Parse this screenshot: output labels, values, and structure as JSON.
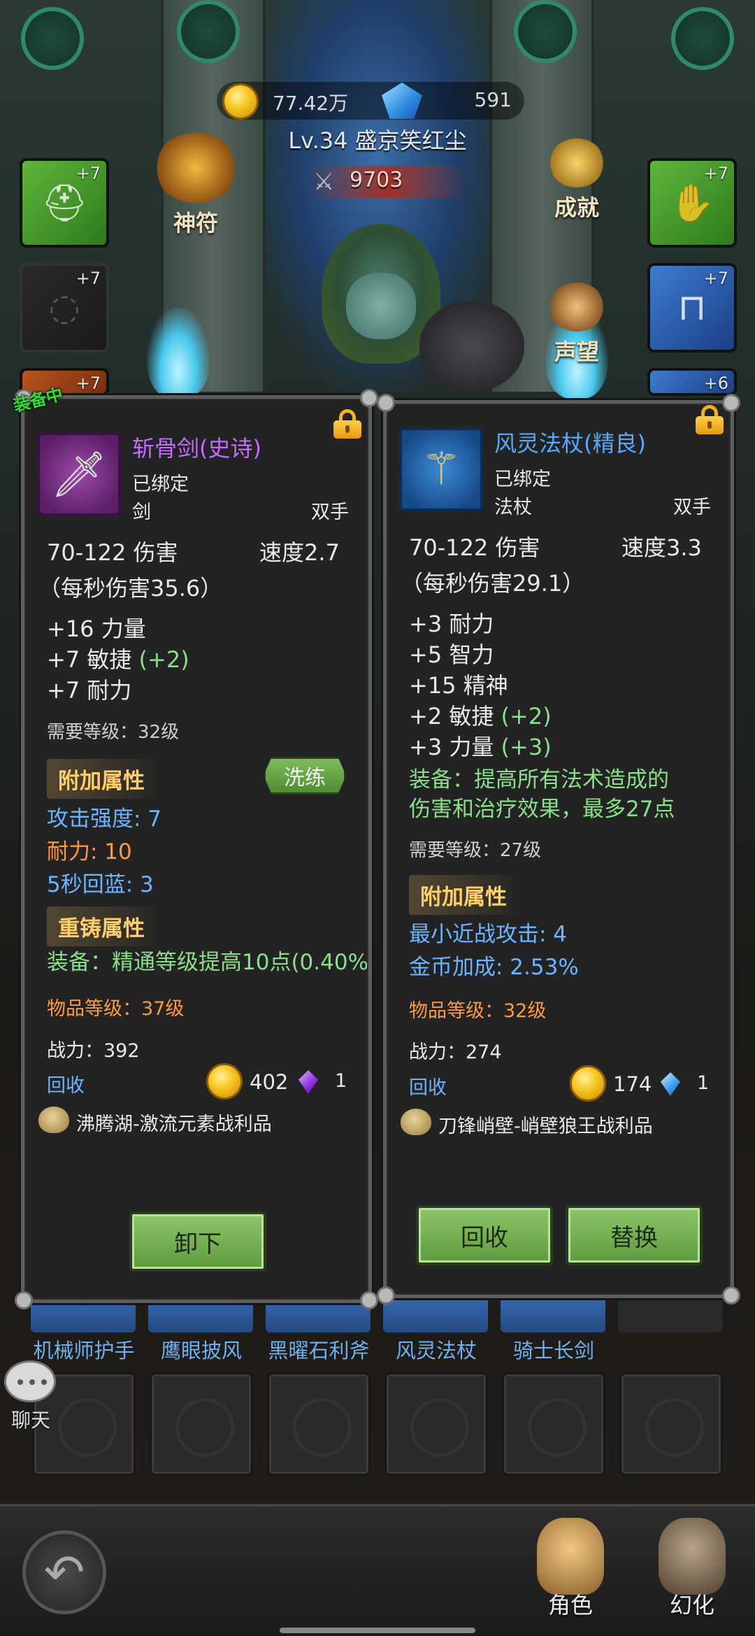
{
  "currency": {
    "gold": "77.42万",
    "gems": "591"
  },
  "player": {
    "name": "Lv.34 盛京笑红尘",
    "power": "9703"
  },
  "slots_left": [
    "+7",
    "+7",
    "+7"
  ],
  "slots_right": [
    "+7",
    "+7",
    "+6"
  ],
  "side_buttons": {
    "rune": "神符",
    "achievement": "成就",
    "reputation": "声望"
  },
  "equipped_tag": "装备中",
  "left_item": {
    "name": "斩骨剑(史诗)",
    "bound": "已绑定",
    "type": "剑",
    "hand": "双手",
    "damage": "70-122 伤害",
    "speed": "速度2.7",
    "dps": "（每秒伤害35.6）",
    "stats": [
      "+16 力量",
      "+7 敏捷",
      "+7 耐力"
    ],
    "stat_bonus": [
      "",
      "(+2)",
      ""
    ],
    "req_level": "需要等级：32级",
    "extra_title": "附加属性",
    "reforge_btn": "洗练",
    "extra_attrs": [
      "攻击强度: 7",
      "耐力: 10",
      "5秒回蓝: 3"
    ],
    "recast_title": "重铸属性",
    "recast_attr": "装备：精通等级提高10点(0.40%)",
    "item_level": "物品等级：37级",
    "power": "战力：392",
    "recycle_label": "回收",
    "recycle_gold": "402",
    "recycle_gem": "1",
    "source": "沸腾湖-激流元素战利品",
    "unequip_btn": "卸下"
  },
  "right_item": {
    "name": "风灵法杖(精良)",
    "bound": "已绑定",
    "type": "法杖",
    "hand": "双手",
    "damage": "70-122 伤害",
    "speed": "速度3.3",
    "dps": "（每秒伤害29.1）",
    "stats": [
      "+3 耐力",
      "+5 智力",
      "+15 精神",
      "+2 敏捷",
      "+3 力量"
    ],
    "stat_bonus": [
      "",
      "",
      "",
      "(+2)",
      "(+3)"
    ],
    "equip_effect": [
      "装备：提高所有法术造成的",
      "伤害和治疗效果，最多27点"
    ],
    "req_level": "需要等级：27级",
    "extra_title": "附加属性",
    "extra_attrs": [
      "最小近战攻击: 4",
      "金币加成: 2.53%"
    ],
    "item_level": "物品等级：32级",
    "power": "战力：274",
    "recycle_label": "回收",
    "recycle_gold": "174",
    "recycle_gem": "1",
    "source": "刀锋峭壁-峭壁狼王战利品",
    "recycle_btn": "回收",
    "replace_btn": "替换"
  },
  "bag_labels": [
    "机械师护手",
    "鹰眼披风",
    "黑曜石利斧",
    "风灵法杖",
    "骑士长剑"
  ],
  "chat_label": "聊天",
  "nav": {
    "character": "角色",
    "transform": "幻化"
  },
  "colors": {
    "epic": "#c26bff",
    "rare": "#55aaff",
    "bonus_green": "#8ae08a",
    "attr_cyan": "#6cb4ff",
    "attr_orange": "#ff9a3c"
  }
}
